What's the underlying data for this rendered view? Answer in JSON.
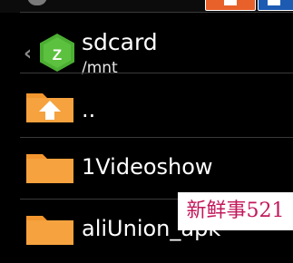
{
  "header": {
    "title": "sdcard",
    "path": "/mnt"
  },
  "files": [
    {
      "label": "..",
      "icon": "folder-up-icon"
    },
    {
      "label": "1Videoshow",
      "icon": "folder-icon"
    },
    {
      "label": "aliUnion_apk",
      "icon": "folder-icon"
    }
  ],
  "watermark": {
    "text": "新鲜事521"
  },
  "colors": {
    "folder_orange": "#f3962e",
    "app_icon_green": "#4caf33",
    "watermark_text": "#c2185b",
    "toolbar_orange": "#e8612a",
    "toolbar_blue": "#1d5bb3"
  }
}
